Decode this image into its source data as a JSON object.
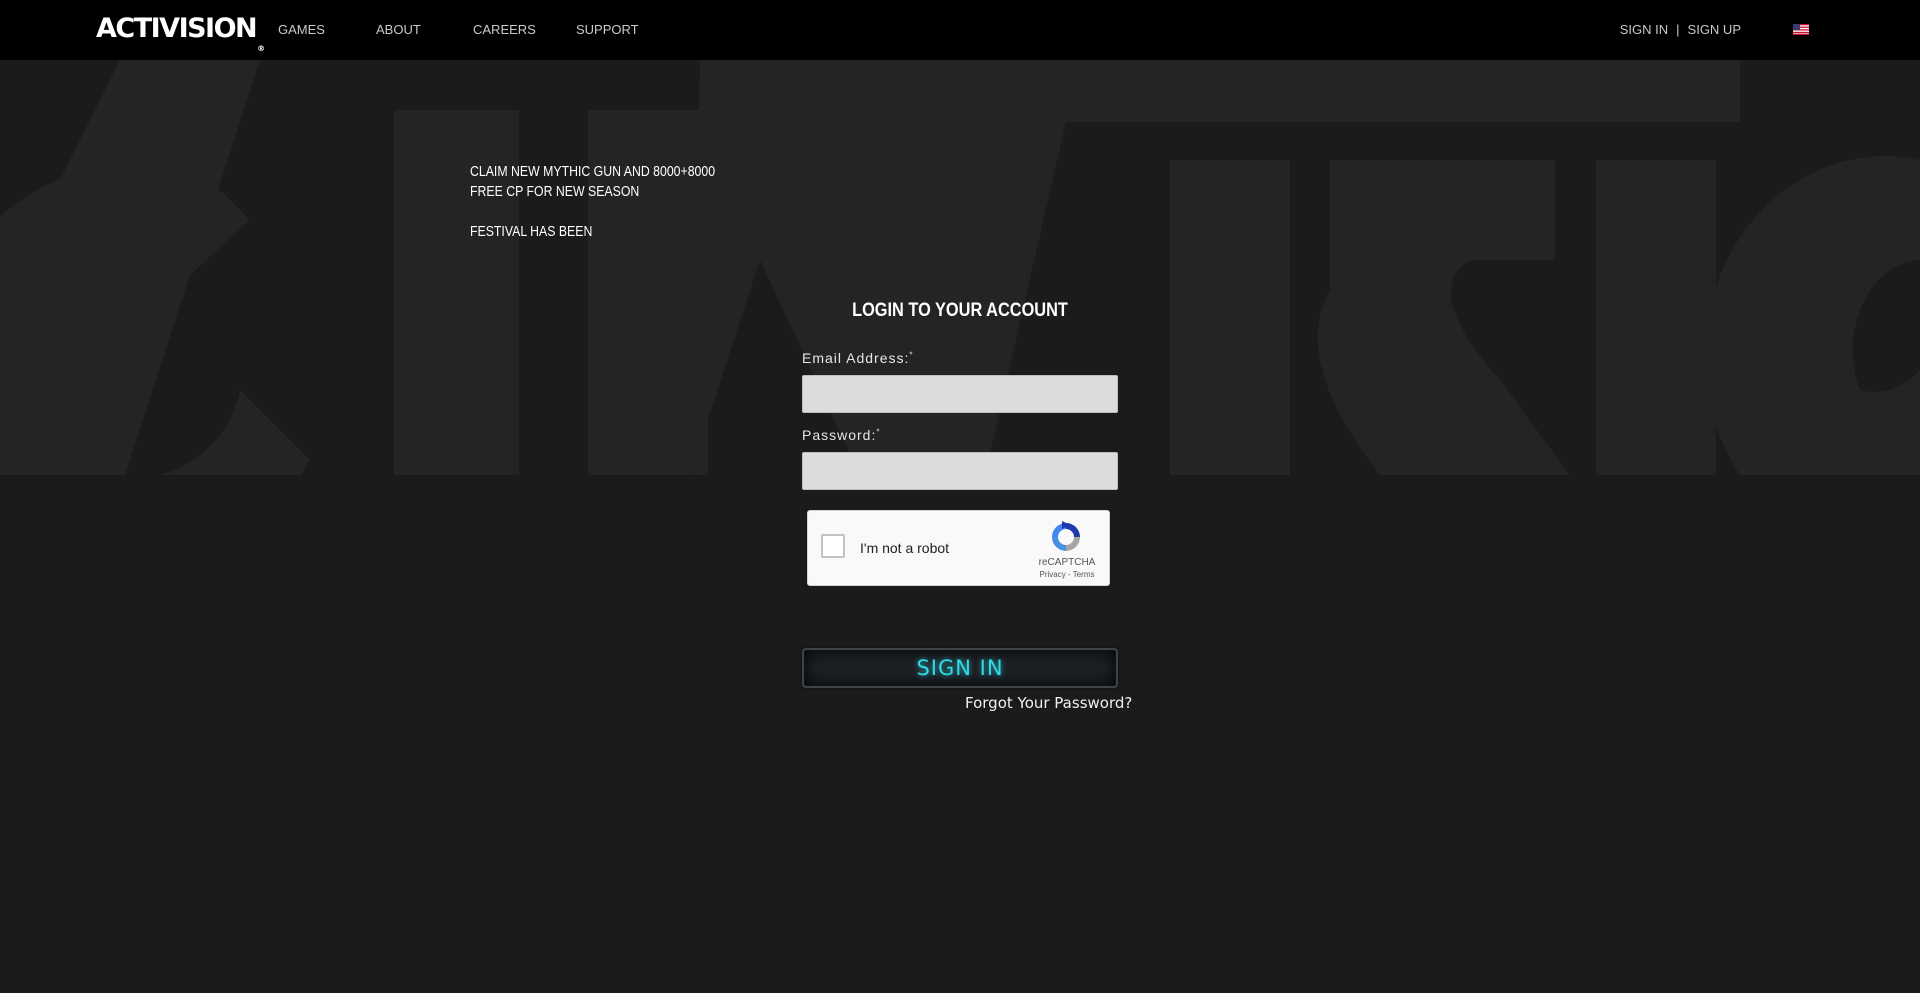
{
  "header": {
    "logo_text": "ACTIVISION",
    "logo_mark": "®",
    "nav": [
      "GAMES",
      "ABOUT",
      "CAREERS",
      "SUPPORT"
    ],
    "sign_in": "SIGN IN",
    "separator": "|",
    "sign_up": "SIGN UP",
    "flag_icon": "us-flag-icon"
  },
  "promo": {
    "line1": " CLAIM NEW MYTHIC GUN AND 8000+8000 FREE CP FOR NEW SEASON",
    "line2": "FESTIVAL HAS BEEN"
  },
  "login": {
    "title": "LOGIN TO YOUR ACCOUNT",
    "email_label": "Email Address:",
    "password_label": "Password:",
    "required_mark": "*",
    "email_value": "",
    "password_value": "",
    "captcha_label": "I'm not a robot",
    "captcha_brand": "reCAPTCHA",
    "captcha_links": "Privacy - Terms",
    "submit_label": "SIGN IN",
    "forgot_label": "Forgot Your Password?"
  },
  "colors": {
    "background": "#1b1b1b",
    "topbar": "#000000",
    "accent_cyan": "#2fd9e6"
  }
}
